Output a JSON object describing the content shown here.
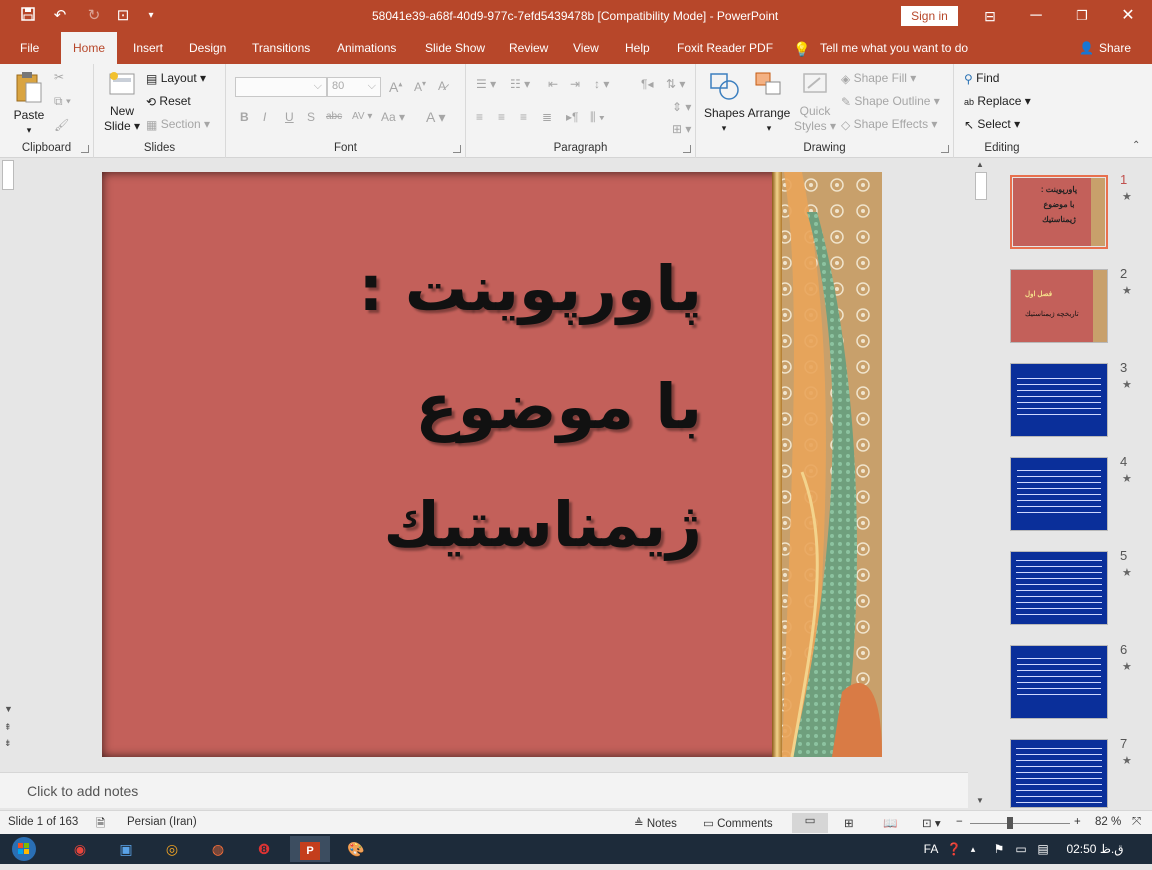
{
  "window": {
    "title": "58041e39-a68f-40d9-977c-7efd5439478b [Compatibility Mode]  -  PowerPoint",
    "sign_in": "Sign in"
  },
  "tabs": [
    "File",
    "Home",
    "Insert",
    "Design",
    "Transitions",
    "Animations",
    "Slide Show",
    "Review",
    "View",
    "Help",
    "Foxit Reader PDF"
  ],
  "tell_me": "Tell me what you want to do",
  "share": "Share",
  "ribbon": {
    "clipboard": {
      "label": "Clipboard",
      "paste": "Paste"
    },
    "slides": {
      "label": "Slides",
      "new_slide_1": "New",
      "new_slide_2": "Slide",
      "layout": "Layout",
      "reset": "Reset",
      "section": "Section"
    },
    "font": {
      "label": "Font",
      "size": "80",
      "bold": "B",
      "italic": "I",
      "underline": "U",
      "shadow": "S",
      "strike": "abc",
      "spacing": "AV",
      "case": "Aa"
    },
    "paragraph": {
      "label": "Paragraph"
    },
    "drawing": {
      "label": "Drawing",
      "shapes": "Shapes",
      "arrange": "Arrange",
      "quick_styles_1": "Quick",
      "quick_styles_2": "Styles",
      "shape_fill": "Shape Fill",
      "shape_outline": "Shape Outline",
      "shape_effects": "Shape Effects"
    },
    "editing": {
      "label": "Editing",
      "find": "Find",
      "replace": "Replace",
      "select": "Select"
    }
  },
  "slide": {
    "title_lines": [
      "پاورپوینت :",
      "با موضوع",
      "ژیمناستیك"
    ]
  },
  "thumbnails": [
    {
      "num": "1",
      "selected": true,
      "lines": [
        "پاورپوینت :",
        "با موضوع",
        "ژیمناستیك"
      ]
    },
    {
      "num": "2",
      "selected": false,
      "lines": [
        "فصل اول",
        "تاريخچه ژيمناستيك"
      ]
    },
    {
      "num": "3",
      "selected": false
    },
    {
      "num": "4",
      "selected": false
    },
    {
      "num": "5",
      "selected": false
    },
    {
      "num": "6",
      "selected": false
    },
    {
      "num": "7",
      "selected": false
    }
  ],
  "notes_placeholder": "Click to add notes",
  "status": {
    "slide_of": "Slide 1 of 163",
    "language": "Persian (Iran)",
    "notes": "Notes",
    "comments": "Comments",
    "zoom": "82 %"
  },
  "taskbar": {
    "lang": "FA",
    "time": "02:50 ق.ظ"
  },
  "colors": {
    "accent": "#b7472a",
    "slide_bg": "#c3605a",
    "thumb_blue": "#0a2f9a"
  }
}
